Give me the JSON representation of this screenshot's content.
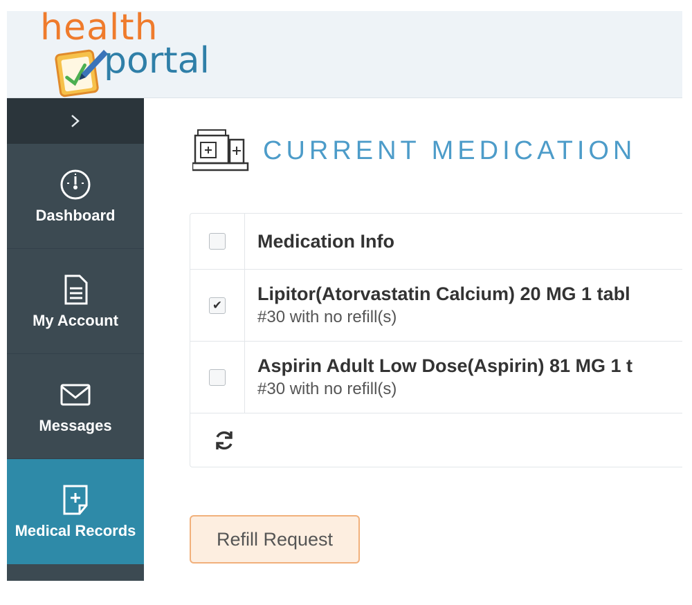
{
  "brand": {
    "line1": "health",
    "line2": "portal"
  },
  "sidebar": {
    "toggle_icon": "chevron-right-icon",
    "items": [
      {
        "label": "Dashboard",
        "icon": "speedometer-icon",
        "active": false
      },
      {
        "label": "My Account",
        "icon": "document-icon",
        "active": false
      },
      {
        "label": "Messages",
        "icon": "envelope-icon",
        "active": false
      },
      {
        "label": "Medical Records",
        "icon": "medical-record-icon",
        "active": true
      }
    ]
  },
  "page": {
    "title": "CURRENT MEDICATION",
    "icon": "pharmacy-icon"
  },
  "table": {
    "header": "Medication Info",
    "rows": [
      {
        "name": "Lipitor(Atorvastatin Calcium) 20 MG 1 tabl",
        "detail": "#30 with no refill(s)",
        "checked": true
      },
      {
        "name": "Aspirin Adult Low Dose(Aspirin) 81 MG 1 t",
        "detail": "#30 with no refill(s)",
        "checked": false
      }
    ],
    "check_mark": "✔"
  },
  "actions": {
    "refill_label": "Refill Request"
  },
  "colors": {
    "brand_orange": "#ef7b2c",
    "brand_blue": "#2f7fa8",
    "sidebar_bg": "#3c4a52",
    "sidebar_active": "#2e8aa8",
    "title_blue": "#4d9cc9",
    "button_bg": "#fdeee0",
    "button_border": "#f1b07b"
  }
}
